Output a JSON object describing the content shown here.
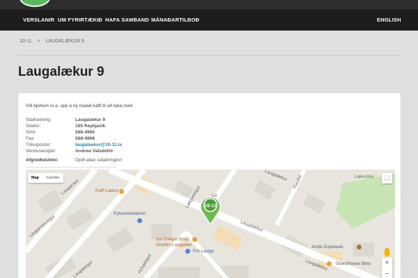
{
  "nav": {
    "items": [
      "VERSLANIR",
      "UM FYRIRTÆKIÐ",
      "HAFA SAMBAND",
      "MÁNAÐARTILBOÐ"
    ],
    "language": "ENGLISH"
  },
  "breadcrumb": {
    "root": "10-11",
    "separator": ">",
    "current": "LAUGALÆKUR 9"
  },
  "page": {
    "title": "Laugalækur 9"
  },
  "store": {
    "intro": "Við bjóðum m.a. upp á ný malað kaffi til að taka með.",
    "rows": [
      {
        "label": "Staðsetning:",
        "value": "Laugalækur 9"
      },
      {
        "label": "Staður:",
        "value": "105 Reykjavík"
      },
      {
        "label": "Sími:",
        "value": "568-4966"
      },
      {
        "label": "Fax:",
        "value": "568-4968"
      },
      {
        "label": "Tölvupóstur:",
        "value": "laugalaekur@10-11.is"
      },
      {
        "label": "Verslunarstjóri:",
        "value": "Andrea Valsdóttir"
      },
      {
        "label": "Afgreiðslutími:",
        "value": "Opið allan sólahringinn"
      }
    ]
  },
  "map": {
    "type_active": "Map",
    "type_inactive": "Satellite",
    "zoom_in": "+",
    "zoom_out": "−",
    "fullscreen": "⛶",
    "marker_text": "10-11",
    "labels": {
      "kaffi": "Kaffi Lækur",
      "pylsu": "Pylsumeistarinn",
      "icecream": "Ice Cream Shop",
      "isbudin": "Ísbúðin Laugalæk",
      "fru": "Frú Lauga",
      "arctic": "Arctic Exposure",
      "guesthouse": "Guesthouse Bina",
      "laugalaekur_top": "Laugalækur",
      "laugalaekur_right": "Laugalækur",
      "laugalaekur_bottom": "Laugalækur",
      "laugarnesvegur": "Laugarnesvegur",
      "laugames": "Laugarnes",
      "laugateigur": "Laugateigur",
      "hrisateigur": "Hrísateigur",
      "laekjarteigur": "Lækjarteigur",
      "raudalaekur": "Rauðal",
      "laekvollur": "Lækvöllur",
      "la": "La"
    },
    "colors": {
      "poi_orange": "#e8a33d",
      "poi_blue": "#5b7fd1",
      "poi_brown": "#9a7a4f",
      "park": "#c9e4b4"
    }
  }
}
